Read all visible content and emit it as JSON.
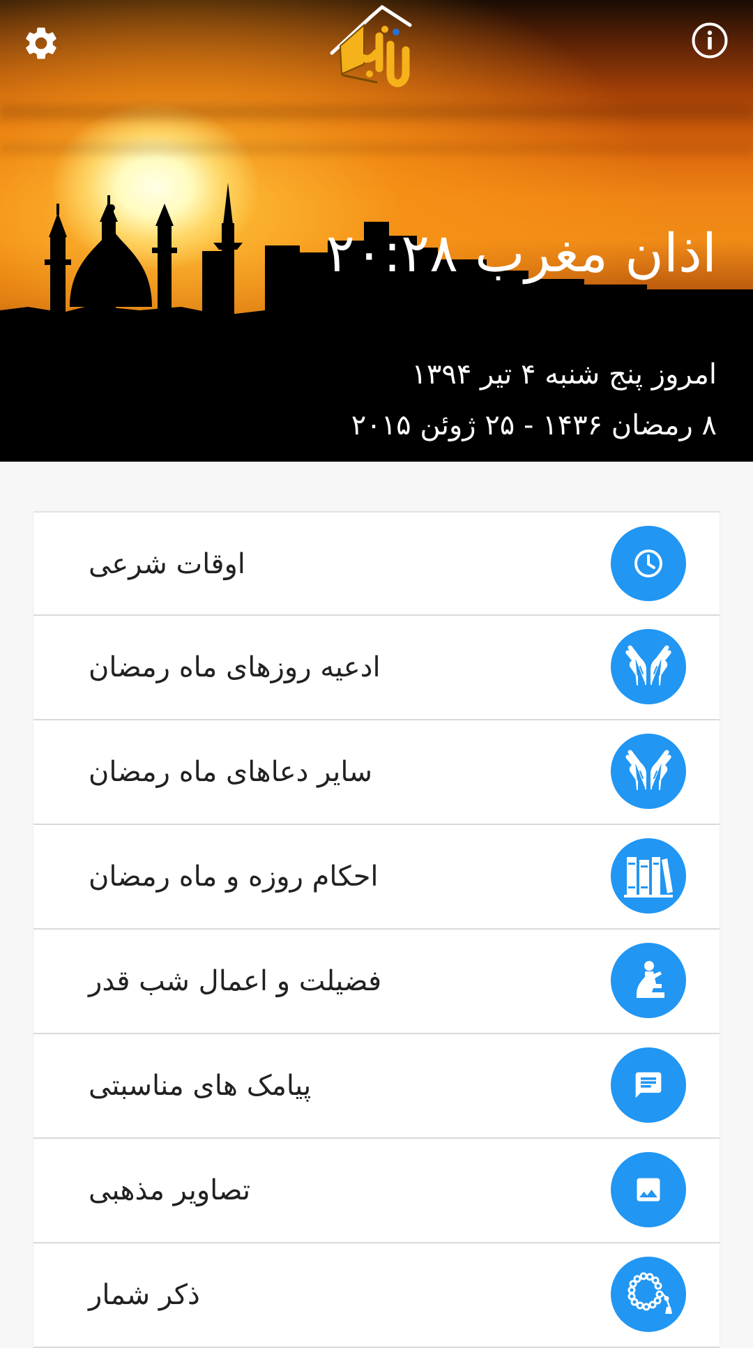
{
  "header": {
    "settings_icon": "gear-icon",
    "info_icon": "info-circle-icon",
    "logo_icon": "rabbana-logo",
    "azan_text": "اذان مغرب ۲۰:۲۸",
    "date_persian": "امروز پنج شنبه ۴ تیر ۱۳۹۴",
    "date_hijri_gregorian": "۸ رمضان ۱۴۳۶ - ۲۵ ژوئن ۲۰۱۵"
  },
  "menu": {
    "items": [
      {
        "label": "اوقات شرعی",
        "icon": "clock-icon"
      },
      {
        "label": "ادعیه روزهای ماه رمضان",
        "icon": "praying-hands-icon"
      },
      {
        "label": "سایر دعاهای ماه رمضان",
        "icon": "praying-hands-icon"
      },
      {
        "label": "احکام روزه و ماه رمضان",
        "icon": "books-icon"
      },
      {
        "label": "فضیلت و اعمال شب قدر",
        "icon": "praying-person-icon"
      },
      {
        "label": "پیامک های مناسبتی",
        "icon": "message-icon"
      },
      {
        "label": "تصاویر مذهبی",
        "icon": "image-icon"
      },
      {
        "label": "ذکر شمار",
        "icon": "prayer-beads-icon"
      }
    ]
  },
  "colors": {
    "accent": "#2196f3",
    "list_background": "#f7f7f7",
    "card_background": "#ffffff",
    "text_primary": "#212121"
  }
}
